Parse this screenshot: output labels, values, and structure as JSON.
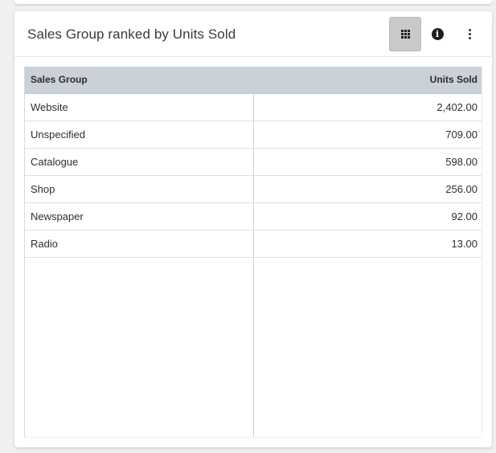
{
  "widget": {
    "title": "Sales Group ranked by Units Sold",
    "toolbar": {
      "grid_icon": "grid-view-icon",
      "info_icon": "info-icon",
      "more_icon": "more-vertical-icon",
      "info_glyph": "i"
    }
  },
  "table": {
    "columns": [
      "Sales Group",
      "Units Sold"
    ],
    "rows": [
      {
        "group": "Website",
        "units": "2,402.00"
      },
      {
        "group": "Unspecified",
        "units": "709.00"
      },
      {
        "group": "Catalogue",
        "units": "598.00"
      },
      {
        "group": "Shop",
        "units": "256.00"
      },
      {
        "group": "Newspaper",
        "units": "92.00"
      },
      {
        "group": "Radio",
        "units": "13.00"
      }
    ]
  },
  "colors": {
    "header_bg": "#cbd1d8",
    "active_button_bg": "#c9c9c9",
    "page_bg": "#f0f0f0"
  }
}
